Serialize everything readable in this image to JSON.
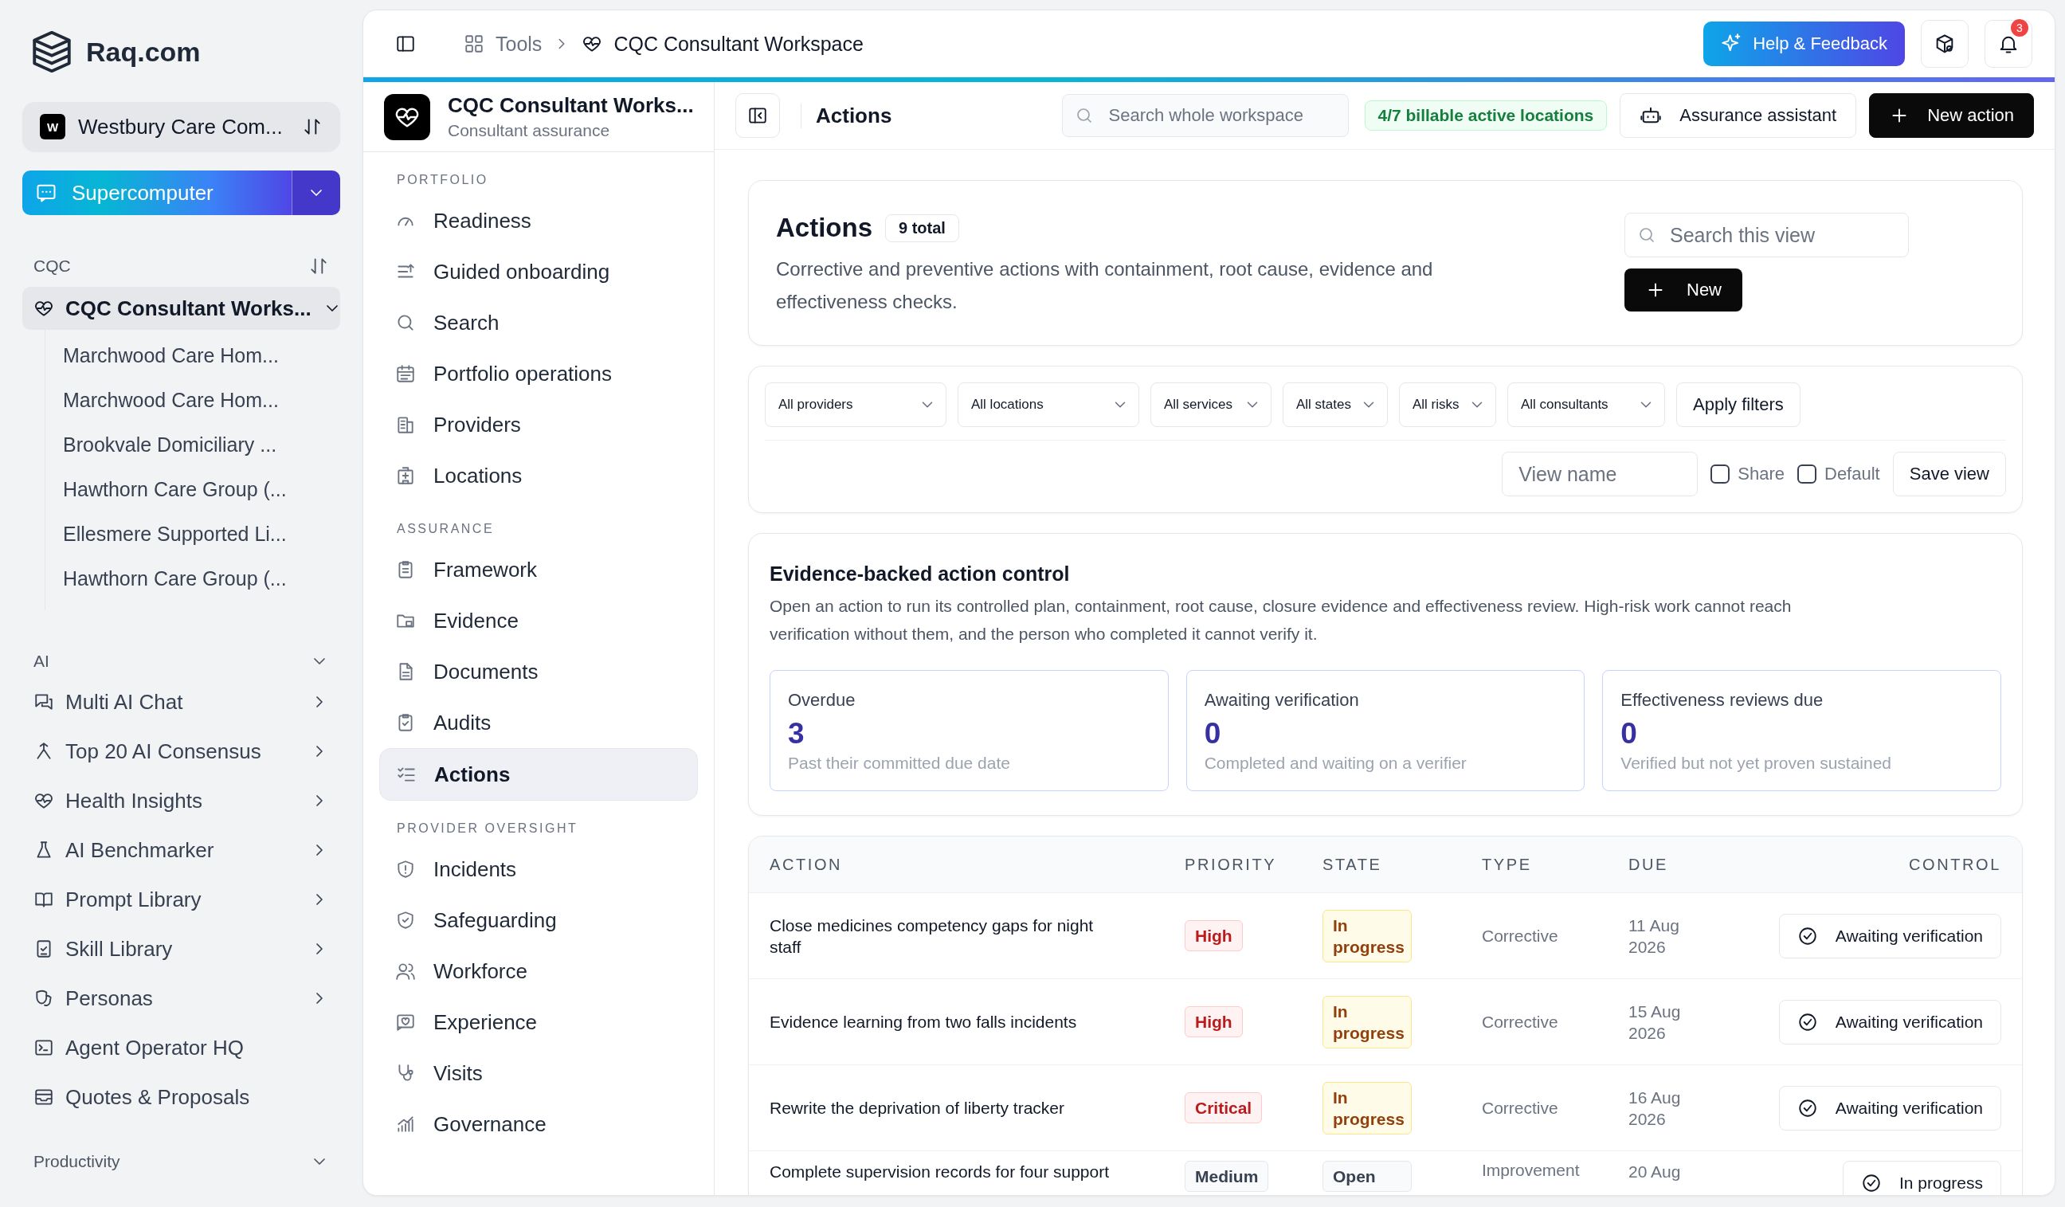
{
  "brand": {
    "name": "Raq.com"
  },
  "workspace_switcher": {
    "initial": "W",
    "label": "Westbury Care Com..."
  },
  "supercomputer_button": {
    "label": "Supercomputer"
  },
  "sidebar": {
    "sections": [
      {
        "title": "CQC",
        "items": [
          {
            "label": "CQC Consultant Works...",
            "kind": "group",
            "selected": true,
            "children": [
              {
                "label": "Marchwood Care Hom..."
              },
              {
                "label": "Marchwood Care Hom..."
              },
              {
                "label": "Brookvale Domiciliary ..."
              },
              {
                "label": "Hawthorn Care Group (..."
              },
              {
                "label": "Ellesmere Supported Li..."
              },
              {
                "label": "Hawthorn Care Group (..."
              }
            ]
          }
        ]
      },
      {
        "title": "AI",
        "items": [
          {
            "label": "Multi AI Chat",
            "kind": "submenu",
            "selected": false
          },
          {
            "label": "Top 20 AI Consensus",
            "kind": "submenu",
            "selected": false
          },
          {
            "label": "Health Insights",
            "kind": "submenu",
            "selected": false
          },
          {
            "label": "AI Benchmarker",
            "kind": "submenu",
            "selected": false
          },
          {
            "label": "Prompt Library",
            "kind": "submenu",
            "selected": false
          },
          {
            "label": "Skill Library",
            "kind": "submenu",
            "selected": false
          },
          {
            "label": "Personas",
            "kind": "submenu",
            "selected": false
          },
          {
            "label": "Agent Operator HQ",
            "kind": "link",
            "selected": false
          },
          {
            "label": "Quotes & Proposals",
            "kind": "link",
            "selected": false
          }
        ]
      },
      {
        "title": "Productivity"
      }
    ]
  },
  "topbar": {
    "breadcrumb": [
      {
        "label": "Tools"
      },
      {
        "label": "CQC Consultant Workspace"
      }
    ],
    "help_button": "Help & Feedback",
    "notification_count": "3"
  },
  "nav": {
    "title": "CQC Consultant Works...",
    "subtitle": "Consultant assurance",
    "sections": [
      {
        "title": "PORTFOLIO",
        "items": [
          {
            "label": "Readiness",
            "selected": false
          },
          {
            "label": "Guided onboarding",
            "selected": false
          },
          {
            "label": "Search",
            "selected": false
          },
          {
            "label": "Portfolio operations",
            "selected": false
          },
          {
            "label": "Providers",
            "selected": false
          },
          {
            "label": "Locations",
            "selected": false
          }
        ]
      },
      {
        "title": "ASSURANCE",
        "items": [
          {
            "label": "Framework",
            "selected": false
          },
          {
            "label": "Evidence",
            "selected": false
          },
          {
            "label": "Documents",
            "selected": false
          },
          {
            "label": "Audits",
            "selected": false
          },
          {
            "label": "Actions",
            "selected": true
          }
        ]
      },
      {
        "title": "PROVIDER OVERSIGHT",
        "items": [
          {
            "label": "Incidents",
            "selected": false
          },
          {
            "label": "Safeguarding",
            "selected": false
          },
          {
            "label": "Workforce",
            "selected": false
          },
          {
            "label": "Experience",
            "selected": false
          },
          {
            "label": "Visits",
            "selected": false
          },
          {
            "label": "Governance",
            "selected": false
          }
        ]
      }
    ]
  },
  "page_header": {
    "title": "Actions",
    "search": {
      "placeholder": "Search whole workspace"
    },
    "billing_badge": "4/7 billable active locations",
    "assistant_button": "Assurance assistant",
    "new_button": "New action"
  },
  "summary": {
    "title": "Actions",
    "count": "9 total",
    "description": "Corrective and preventive actions with containment, root cause, evidence and effectiveness checks.",
    "search": {
      "placeholder": "Search this view"
    },
    "new_button": "New"
  },
  "filters": {
    "dropdowns": [
      "All providers",
      "All locations",
      "All services",
      "All states",
      "All risks",
      "All consultants"
    ],
    "apply_button": "Apply filters",
    "view_name": {
      "placeholder": "View name"
    },
    "checkboxes": [
      {
        "label": "Share",
        "checked": false
      },
      {
        "label": "Default",
        "checked": false
      }
    ],
    "save_button": "Save view"
  },
  "control": {
    "title": "Evidence-backed action control",
    "description": "Open an action to run its controlled plan, containment, root cause, closure evidence and effectiveness review. High-risk work cannot reach verification without them, and the person who completed it cannot verify it.",
    "stats": [
      {
        "label": "Overdue",
        "value": "3",
        "note": "Past their committed due date"
      },
      {
        "label": "Awaiting verification",
        "value": "0",
        "note": "Completed and waiting on a verifier"
      },
      {
        "label": "Effectiveness reviews due",
        "value": "0",
        "note": "Verified but not yet proven sustained"
      }
    ]
  },
  "table": {
    "columns": [
      "ACTION",
      "PRIORITY",
      "STATE",
      "TYPE",
      "DUE",
      "CONTROL"
    ],
    "rows": [
      {
        "action": "Close medicines competency gaps for night staff",
        "priority": {
          "label": "High",
          "kind": "danger"
        },
        "state": {
          "label": "In progress",
          "kind": "warning"
        },
        "type": "Corrective",
        "due": "11 Aug 2026",
        "control": "Awaiting verification"
      },
      {
        "action": "Evidence learning from two falls incidents",
        "priority": {
          "label": "High",
          "kind": "danger"
        },
        "state": {
          "label": "In progress",
          "kind": "warning"
        },
        "type": "Corrective",
        "due": "15 Aug 2026",
        "control": "Awaiting verification"
      },
      {
        "action": "Rewrite the deprivation of liberty tracker",
        "priority": {
          "label": "Critical",
          "kind": "danger"
        },
        "state": {
          "label": "In progress",
          "kind": "warning"
        },
        "type": "Corrective",
        "due": "16 Aug 2026",
        "control": "Awaiting verification"
      },
      {
        "action": "Complete supervision records for four support",
        "priority": {
          "label": "Medium",
          "kind": "neutral"
        },
        "state": {
          "label": "Open",
          "kind": "neutral"
        },
        "type": "Improvement",
        "due": "20 Aug",
        "control": "In progress"
      }
    ]
  }
}
